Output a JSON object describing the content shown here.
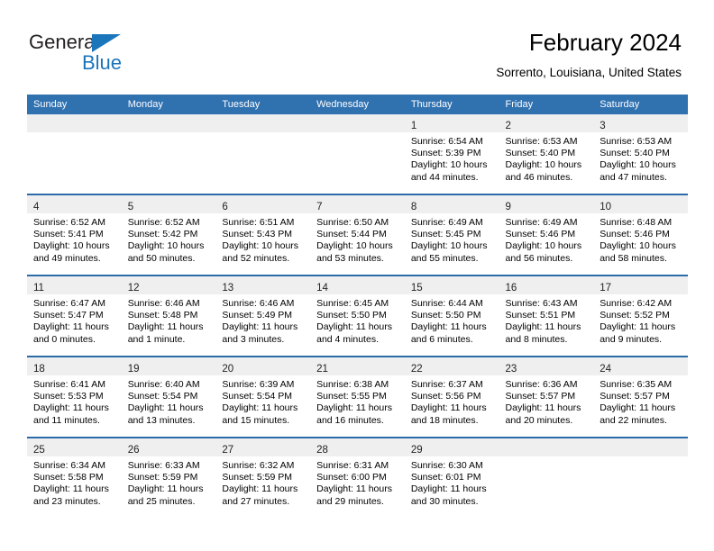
{
  "brand": {
    "name_part1": "General",
    "name_part2": "Blue",
    "accent_color": "#1b75bb"
  },
  "header": {
    "title": "February 2024",
    "subtitle": "Sorrento, Louisiana, United States",
    "header_bg": "#3071b0",
    "row_divider": "#2b6ca8",
    "daynum_bg": "#efefef"
  },
  "weekday_headers": [
    "Sunday",
    "Monday",
    "Tuesday",
    "Wednesday",
    "Thursday",
    "Friday",
    "Saturday"
  ],
  "weeks": [
    [
      {
        "day": "",
        "sunrise": "",
        "sunset": "",
        "daylight1": "",
        "daylight2": ""
      },
      {
        "day": "",
        "sunrise": "",
        "sunset": "",
        "daylight1": "",
        "daylight2": ""
      },
      {
        "day": "",
        "sunrise": "",
        "sunset": "",
        "daylight1": "",
        "daylight2": ""
      },
      {
        "day": "",
        "sunrise": "",
        "sunset": "",
        "daylight1": "",
        "daylight2": ""
      },
      {
        "day": "1",
        "sunrise": "Sunrise: 6:54 AM",
        "sunset": "Sunset: 5:39 PM",
        "daylight1": "Daylight: 10 hours",
        "daylight2": "and 44 minutes."
      },
      {
        "day": "2",
        "sunrise": "Sunrise: 6:53 AM",
        "sunset": "Sunset: 5:40 PM",
        "daylight1": "Daylight: 10 hours",
        "daylight2": "and 46 minutes."
      },
      {
        "day": "3",
        "sunrise": "Sunrise: 6:53 AM",
        "sunset": "Sunset: 5:40 PM",
        "daylight1": "Daylight: 10 hours",
        "daylight2": "and 47 minutes."
      }
    ],
    [
      {
        "day": "4",
        "sunrise": "Sunrise: 6:52 AM",
        "sunset": "Sunset: 5:41 PM",
        "daylight1": "Daylight: 10 hours",
        "daylight2": "and 49 minutes."
      },
      {
        "day": "5",
        "sunrise": "Sunrise: 6:52 AM",
        "sunset": "Sunset: 5:42 PM",
        "daylight1": "Daylight: 10 hours",
        "daylight2": "and 50 minutes."
      },
      {
        "day": "6",
        "sunrise": "Sunrise: 6:51 AM",
        "sunset": "Sunset: 5:43 PM",
        "daylight1": "Daylight: 10 hours",
        "daylight2": "and 52 minutes."
      },
      {
        "day": "7",
        "sunrise": "Sunrise: 6:50 AM",
        "sunset": "Sunset: 5:44 PM",
        "daylight1": "Daylight: 10 hours",
        "daylight2": "and 53 minutes."
      },
      {
        "day": "8",
        "sunrise": "Sunrise: 6:49 AM",
        "sunset": "Sunset: 5:45 PM",
        "daylight1": "Daylight: 10 hours",
        "daylight2": "and 55 minutes."
      },
      {
        "day": "9",
        "sunrise": "Sunrise: 6:49 AM",
        "sunset": "Sunset: 5:46 PM",
        "daylight1": "Daylight: 10 hours",
        "daylight2": "and 56 minutes."
      },
      {
        "day": "10",
        "sunrise": "Sunrise: 6:48 AM",
        "sunset": "Sunset: 5:46 PM",
        "daylight1": "Daylight: 10 hours",
        "daylight2": "and 58 minutes."
      }
    ],
    [
      {
        "day": "11",
        "sunrise": "Sunrise: 6:47 AM",
        "sunset": "Sunset: 5:47 PM",
        "daylight1": "Daylight: 11 hours",
        "daylight2": "and 0 minutes."
      },
      {
        "day": "12",
        "sunrise": "Sunrise: 6:46 AM",
        "sunset": "Sunset: 5:48 PM",
        "daylight1": "Daylight: 11 hours",
        "daylight2": "and 1 minute."
      },
      {
        "day": "13",
        "sunrise": "Sunrise: 6:46 AM",
        "sunset": "Sunset: 5:49 PM",
        "daylight1": "Daylight: 11 hours",
        "daylight2": "and 3 minutes."
      },
      {
        "day": "14",
        "sunrise": "Sunrise: 6:45 AM",
        "sunset": "Sunset: 5:50 PM",
        "daylight1": "Daylight: 11 hours",
        "daylight2": "and 4 minutes."
      },
      {
        "day": "15",
        "sunrise": "Sunrise: 6:44 AM",
        "sunset": "Sunset: 5:50 PM",
        "daylight1": "Daylight: 11 hours",
        "daylight2": "and 6 minutes."
      },
      {
        "day": "16",
        "sunrise": "Sunrise: 6:43 AM",
        "sunset": "Sunset: 5:51 PM",
        "daylight1": "Daylight: 11 hours",
        "daylight2": "and 8 minutes."
      },
      {
        "day": "17",
        "sunrise": "Sunrise: 6:42 AM",
        "sunset": "Sunset: 5:52 PM",
        "daylight1": "Daylight: 11 hours",
        "daylight2": "and 9 minutes."
      }
    ],
    [
      {
        "day": "18",
        "sunrise": "Sunrise: 6:41 AM",
        "sunset": "Sunset: 5:53 PM",
        "daylight1": "Daylight: 11 hours",
        "daylight2": "and 11 minutes."
      },
      {
        "day": "19",
        "sunrise": "Sunrise: 6:40 AM",
        "sunset": "Sunset: 5:54 PM",
        "daylight1": "Daylight: 11 hours",
        "daylight2": "and 13 minutes."
      },
      {
        "day": "20",
        "sunrise": "Sunrise: 6:39 AM",
        "sunset": "Sunset: 5:54 PM",
        "daylight1": "Daylight: 11 hours",
        "daylight2": "and 15 minutes."
      },
      {
        "day": "21",
        "sunrise": "Sunrise: 6:38 AM",
        "sunset": "Sunset: 5:55 PM",
        "daylight1": "Daylight: 11 hours",
        "daylight2": "and 16 minutes."
      },
      {
        "day": "22",
        "sunrise": "Sunrise: 6:37 AM",
        "sunset": "Sunset: 5:56 PM",
        "daylight1": "Daylight: 11 hours",
        "daylight2": "and 18 minutes."
      },
      {
        "day": "23",
        "sunrise": "Sunrise: 6:36 AM",
        "sunset": "Sunset: 5:57 PM",
        "daylight1": "Daylight: 11 hours",
        "daylight2": "and 20 minutes."
      },
      {
        "day": "24",
        "sunrise": "Sunrise: 6:35 AM",
        "sunset": "Sunset: 5:57 PM",
        "daylight1": "Daylight: 11 hours",
        "daylight2": "and 22 minutes."
      }
    ],
    [
      {
        "day": "25",
        "sunrise": "Sunrise: 6:34 AM",
        "sunset": "Sunset: 5:58 PM",
        "daylight1": "Daylight: 11 hours",
        "daylight2": "and 23 minutes."
      },
      {
        "day": "26",
        "sunrise": "Sunrise: 6:33 AM",
        "sunset": "Sunset: 5:59 PM",
        "daylight1": "Daylight: 11 hours",
        "daylight2": "and 25 minutes."
      },
      {
        "day": "27",
        "sunrise": "Sunrise: 6:32 AM",
        "sunset": "Sunset: 5:59 PM",
        "daylight1": "Daylight: 11 hours",
        "daylight2": "and 27 minutes."
      },
      {
        "day": "28",
        "sunrise": "Sunrise: 6:31 AM",
        "sunset": "Sunset: 6:00 PM",
        "daylight1": "Daylight: 11 hours",
        "daylight2": "and 29 minutes."
      },
      {
        "day": "29",
        "sunrise": "Sunrise: 6:30 AM",
        "sunset": "Sunset: 6:01 PM",
        "daylight1": "Daylight: 11 hours",
        "daylight2": "and 30 minutes."
      },
      {
        "day": "",
        "sunrise": "",
        "sunset": "",
        "daylight1": "",
        "daylight2": ""
      },
      {
        "day": "",
        "sunrise": "",
        "sunset": "",
        "daylight1": "",
        "daylight2": ""
      }
    ]
  ]
}
